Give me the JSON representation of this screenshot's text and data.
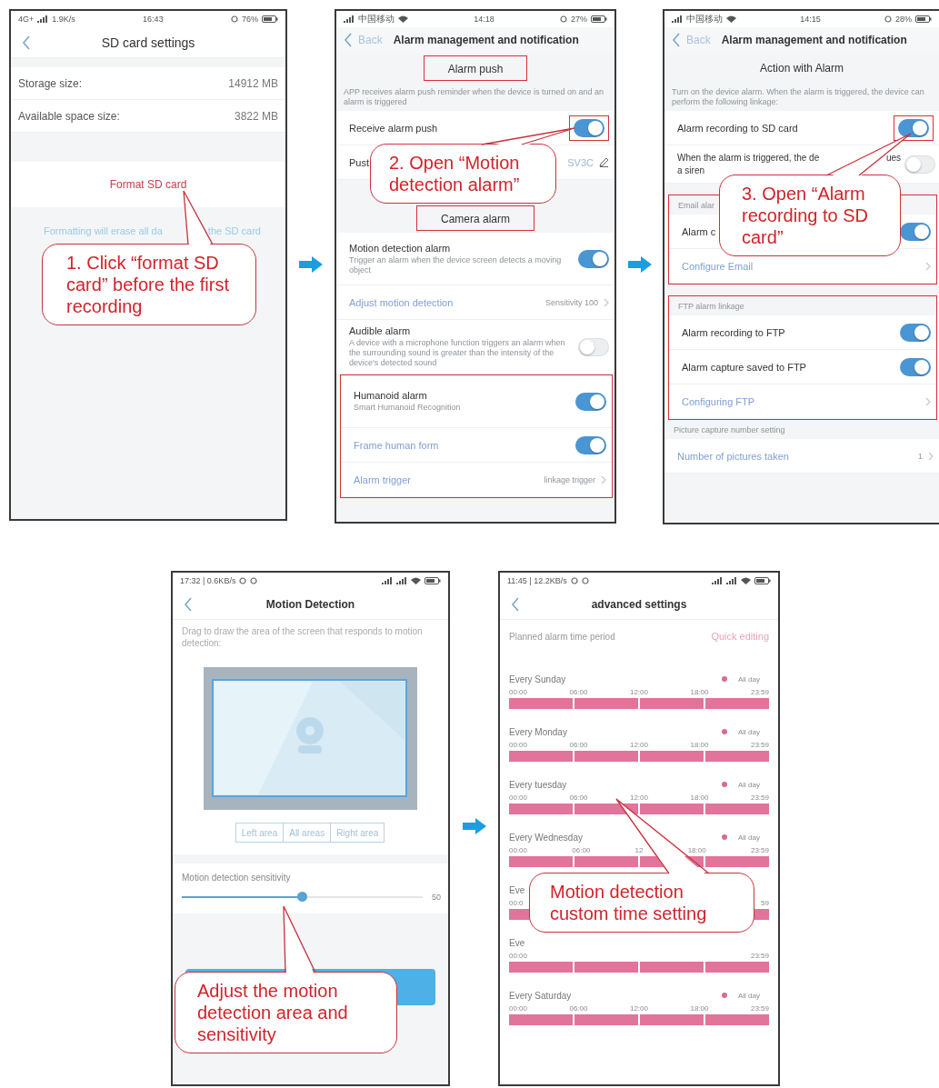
{
  "screens": [
    {
      "kind": "sd_card",
      "status_bar": {
        "left": [
          "4G+",
          "1.9K/s"
        ],
        "time": "16:43",
        "battery": "76%"
      },
      "title": "SD card settings",
      "rows": [
        {
          "label": "Storage size:",
          "value": "14912 MB"
        },
        {
          "label": "Available space size:",
          "value": "3822 MB"
        }
      ],
      "action": "Format SD card",
      "hint_parts": [
        "Formatting will erase all da",
        "the SD card"
      ],
      "callout": "1. Click “format SD card” before the first recording"
    },
    {
      "kind": "alarm_push",
      "status_bar": {
        "carrier": "中国移动",
        "time": "14:18",
        "battery": "27%"
      },
      "back": "Back",
      "title": "Alarm management and notification",
      "items": [
        {
          "kind": "header",
          "text": "Alarm push",
          "highlighted": true
        },
        {
          "kind": "note",
          "text": "APP receives alarm push reminder when the device is turned on and an alarm is triggered"
        },
        {
          "kind": "switch",
          "label": "Receive alarm push",
          "on": true,
          "highlighted": true,
          "link": false
        },
        {
          "kind": "edit",
          "label": "Pust",
          "value": "SV3C"
        },
        {
          "kind": "header",
          "text": "Camera alarm",
          "highlighted": true
        },
        {
          "kind": "switch",
          "label": "Motion detection alarm",
          "sub": "Trigger an alarm when the device screen detects a moving object",
          "on": true,
          "highlighted": false,
          "link": false
        },
        {
          "kind": "link",
          "label": "Adjust motion detection",
          "value": "Sensitivity 100"
        },
        {
          "kind": "switch",
          "label": "Audible alarm",
          "sub": "A device with a microphone function triggers an alarm when the surrounding sound is greater than the intensity of the device's detected sound",
          "on": false,
          "highlighted": false,
          "link": false
        },
        {
          "kind": "group",
          "highlighted": true,
          "children": [
            {
              "kind": "switch",
              "label": "Humanoid alarm",
              "sub": "Smart Humanoid Recognition",
              "on": true,
              "highlighted": false,
              "link": false
            },
            {
              "kind": "switch",
              "label": "Frame human form",
              "on": true,
              "highlighted": false,
              "link": true
            },
            {
              "kind": "link",
              "label": "Alarm trigger",
              "value": "linkage trigger"
            }
          ]
        }
      ],
      "callout": "2. Open “Motion detection alarm”"
    },
    {
      "kind": "alarm_actions",
      "status_bar": {
        "carrier": "中国移动",
        "time": "14:15",
        "battery": "28%"
      },
      "back": "Back",
      "title": "Alarm management and notification",
      "items": [
        {
          "kind": "header",
          "text": "Action with Alarm",
          "highlighted": false
        },
        {
          "kind": "note",
          "text": "Turn on the device alarm. When the alarm is triggered, the device can perform the following linkage:"
        },
        {
          "kind": "switch",
          "label": "Alarm recording to SD card",
          "on": true,
          "highlighted": true,
          "link": false
        },
        {
          "kind": "split_switch",
          "parts": [
            "When the alarm is triggered, the de",
            "ues"
          ],
          "line2": "a siren",
          "on": false
        },
        {
          "kind": "group",
          "highlighted": true,
          "children": [
            {
              "kind": "section_label",
              "text": "Email alar"
            },
            {
              "kind": "switch",
              "label": "Alarm c",
              "on": true,
              "highlighted": false,
              "link": false
            },
            {
              "kind": "link",
              "label": "Configure Email"
            }
          ]
        },
        {
          "kind": "group",
          "highlighted": true,
          "children": [
            {
              "kind": "section_label",
              "text": "FTP alarm linkage"
            },
            {
              "kind": "switch",
              "label": "Alarm recording to FTP",
              "on": true,
              "highlighted": false,
              "link": false
            },
            {
              "kind": "switch",
              "label": "Alarm capture saved to FTP",
              "on": true,
              "highlighted": false,
              "link": false
            },
            {
              "kind": "link",
              "label": "Configuring FTP"
            }
          ]
        },
        {
          "kind": "section_label",
          "text": "Picture capture number setting"
        },
        {
          "kind": "link",
          "label": "Number of pictures taken",
          "value": "1"
        }
      ],
      "callout": "3. Open “Alarm recording to SD card”"
    },
    {
      "kind": "motion_area",
      "status_bar": {
        "left": [
          "17:32 | 0.6KB/s"
        ]
      },
      "title": "Motion Detection",
      "note": "Drag to draw the area of the screen that responds to motion detection:",
      "area_buttons": [
        "Left area",
        "All areas",
        "Right area"
      ],
      "sensitivity": {
        "label": "Motion detection sensitivity",
        "level": 0.5,
        "value": "50"
      },
      "callout": "Adjust the motion detection area and sensitivity"
    },
    {
      "kind": "schedule",
      "status_bar": {
        "left": [
          "11:45 | 12.2KB/s"
        ]
      },
      "title": "advanced settings",
      "period_label": "Planned alarm time period",
      "quick_edit": "Quick editing",
      "days": [
        {
          "label": "Every Sunday",
          "all_day": "All day",
          "ticks": [
            "00:00",
            "06:00",
            "12:00",
            "18:00",
            "23:59"
          ]
        },
        {
          "label": "Every Monday",
          "all_day": "All day",
          "ticks": [
            "00:00",
            "06:00",
            "12:00",
            "18:00",
            "23:59"
          ]
        },
        {
          "label": "Every tuesday",
          "all_day": "All day",
          "ticks": [
            "00:00",
            "06:00",
            "12:00",
            "18:00",
            "23:59"
          ]
        },
        {
          "label": "Every Wednesday",
          "all_day": "All day",
          "ticks": [
            "00:00",
            "06:00",
            "12",
            "18:00",
            "23:59"
          ]
        },
        {
          "label": "Eve",
          "ticks": [
            "00:0",
            "59"
          ]
        },
        {
          "label": "Eve",
          "ticks": [
            "00:00",
            "23:59"
          ]
        },
        {
          "label": "Every Saturday",
          "all_day": "All day",
          "ticks": [
            "00:00",
            "06:00",
            "12:00",
            "18:00",
            "23:59"
          ]
        }
      ],
      "callout": "Motion detection custom time setting"
    }
  ]
}
